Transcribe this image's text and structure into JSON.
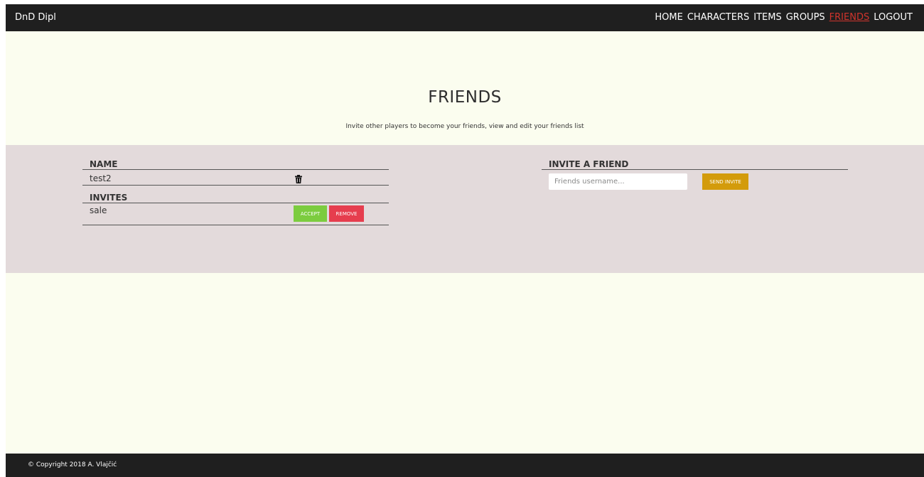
{
  "navbar": {
    "brand": "DnD Dipl",
    "links": [
      "HOME",
      "CHARACTERS",
      "ITEMS",
      "GROUPS",
      "FRIENDS",
      "LOGOUT"
    ],
    "active": "FRIENDS"
  },
  "hero": {
    "title": "FRIENDS",
    "subtitle": "Invite other players to become your friends, view and edit your friends list"
  },
  "friends": {
    "name_header": "NAME",
    "rows": [
      {
        "name": "test2",
        "action_icon": "trash-icon"
      }
    ],
    "invites_header": "INVITES",
    "invites": [
      {
        "name": "sale",
        "accept_label": "ACCEPT",
        "remove_label": "REMOVE"
      }
    ]
  },
  "invite": {
    "header": "INVITE A FRIEND",
    "placeholder": "Friends username...",
    "button_label": "SEND INVITE"
  },
  "footer": {
    "copyright": "© Copyright 2018 A. Vlajčić"
  },
  "colors": {
    "background": "#fbfdef",
    "panel": "#e3dadb",
    "navbar": "#1f1f1f",
    "active_link": "#d0342c",
    "accept": "#7ccc3f",
    "remove": "#e63d4e",
    "send_invite": "#d39b0b"
  }
}
